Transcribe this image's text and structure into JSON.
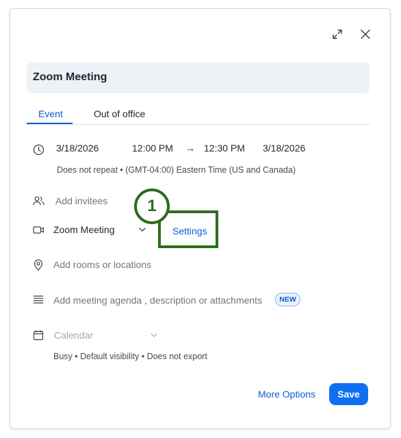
{
  "header": {
    "expand_icon": "expand-icon",
    "close_icon": "close-icon"
  },
  "meeting": {
    "title": "Zoom Meeting"
  },
  "tabs": [
    {
      "label": "Event",
      "active": true
    },
    {
      "label": "Out of office",
      "active": false
    }
  ],
  "schedule": {
    "start_date": "3/18/2026",
    "start_time": "12:00 PM",
    "arrow": "→",
    "end_time": "12:30 PM",
    "end_date": "3/18/2026",
    "recurrence_tz": "Does not repeat • (GMT-04:00) Eastern Time (US and Canada)"
  },
  "invitees": {
    "placeholder": "Add invitees"
  },
  "conference": {
    "provider": "Zoom Meeting",
    "settings_label": "Settings"
  },
  "annotation": {
    "callout_number": "1",
    "color": "#2e6b1f"
  },
  "location": {
    "placeholder": "Add rooms or locations"
  },
  "agenda": {
    "placeholder": "Add meeting agenda , description or attachments",
    "new_badge": "NEW"
  },
  "calendar": {
    "placeholder": "Calendar",
    "details": "Busy • Default visibility • Does not export"
  },
  "footer": {
    "more_options_label": "More Options",
    "save_label": "Save"
  },
  "colors": {
    "accent": "#0e5ccf",
    "save_button": "#0e6ff3"
  }
}
